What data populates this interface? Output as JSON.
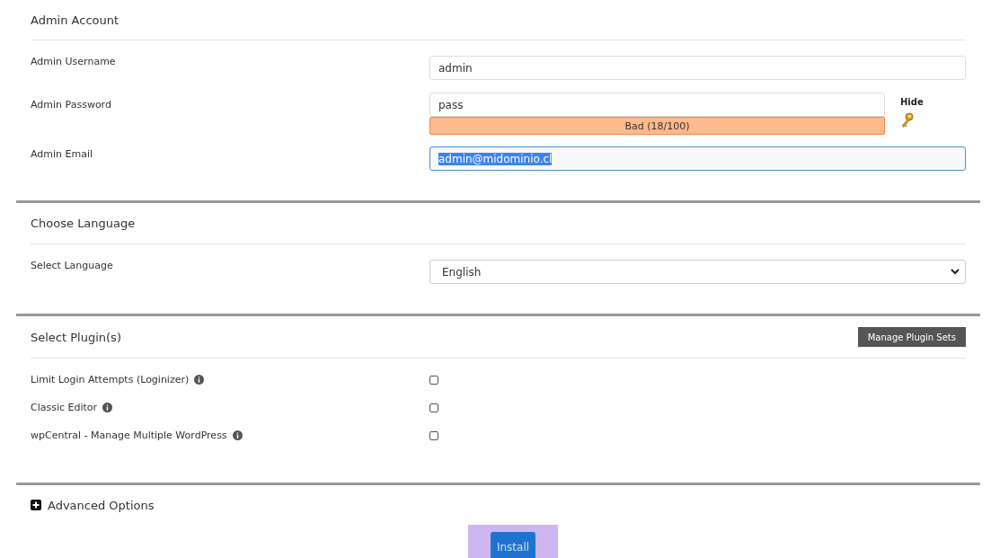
{
  "admin_account": {
    "title": "Admin Account",
    "username": {
      "label": "Admin Username",
      "value": "admin"
    },
    "password": {
      "label": "Admin Password",
      "value": "pass",
      "strength": "Bad (18/100)",
      "toggle": "Hide"
    },
    "email": {
      "label": "Admin Email",
      "value": "admin@midominio.cl",
      "focused": true,
      "text_selected": true
    }
  },
  "language": {
    "title": "Choose Language",
    "label": "Select Language",
    "value": "English"
  },
  "plugins": {
    "title": "Select Plugin(s)",
    "manage_button": "Manage Plugin Sets",
    "items": [
      {
        "label": "Limit Login Attempts (Loginizer)",
        "checked": false
      },
      {
        "label": "Classic Editor",
        "checked": false
      },
      {
        "label": "wpCentral - Manage Multiple WordPress",
        "checked": false
      }
    ]
  },
  "advanced": {
    "label": "Advanced Options",
    "expanded": false
  },
  "install_button": "Install"
}
